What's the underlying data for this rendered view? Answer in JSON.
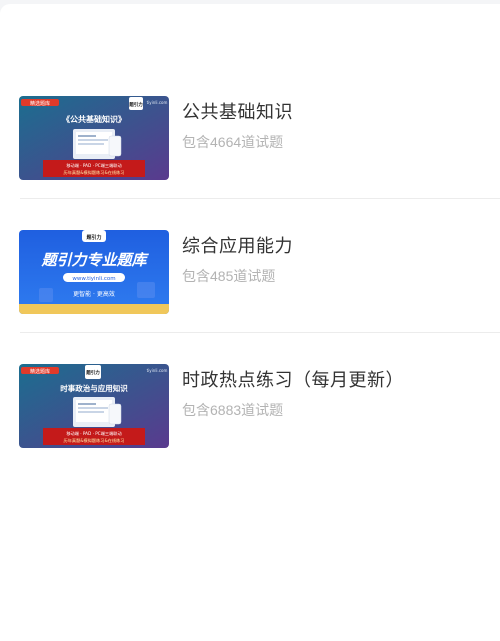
{
  "items": [
    {
      "title": "公共基础知识",
      "count": "包含4664道试题",
      "thumb": {
        "badge": "精选题库",
        "brand_top": "题引力",
        "site": "tiyinli.com",
        "heading": "《公共基础知识》",
        "line1": "移动端 · PAD · PC端三端联动",
        "line2": "历年真题&模拟题练习&在线练习"
      }
    },
    {
      "title": "综合应用能力",
      "count": "包含485道试题",
      "thumb": {
        "heading": "题引力专业题库",
        "site": "www.tiyinli.com",
        "tagline": "更智能 · 更高效",
        "logo": "题引力"
      }
    },
    {
      "title": "时政热点练习（每月更新）",
      "count": "包含6883道试题",
      "thumb": {
        "badge": "精选题库",
        "brand_top": "题引力",
        "site": "tiyinli.com",
        "heading": "时事政治与应用知识",
        "line1": "移动端 · PAD · PC端三端联动",
        "line2": "历年真题&模拟题练习&在线练习"
      }
    }
  ]
}
